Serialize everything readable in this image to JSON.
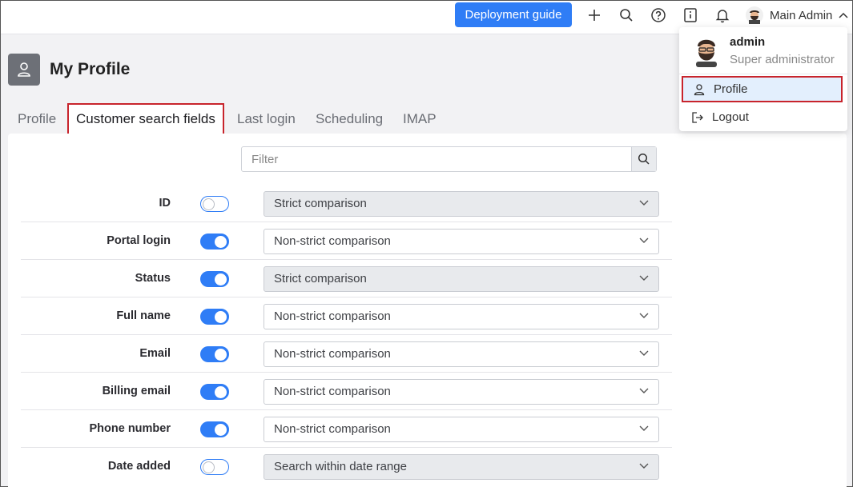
{
  "topbar": {
    "deploy_label": "Deployment guide",
    "icons": [
      "plus-icon",
      "search-icon",
      "help-icon",
      "info-icon",
      "bell-icon"
    ],
    "user_label": "Main Admin"
  },
  "page": {
    "title": "My Profile"
  },
  "tabs": [
    {
      "label": "Profile",
      "active": false
    },
    {
      "label": "Customer search fields",
      "active": true
    },
    {
      "label": "Last login",
      "active": false
    },
    {
      "label": "Scheduling",
      "active": false
    },
    {
      "label": "IMAP",
      "active": false
    }
  ],
  "filter": {
    "placeholder": "Filter",
    "value": ""
  },
  "fields": [
    {
      "label": "ID",
      "enabled": false,
      "mode": "Strict comparison"
    },
    {
      "label": "Portal login",
      "enabled": true,
      "mode": "Non-strict comparison"
    },
    {
      "label": "Status",
      "enabled": true,
      "mode": "Strict comparison",
      "select_disabled": true
    },
    {
      "label": "Full name",
      "enabled": true,
      "mode": "Non-strict comparison"
    },
    {
      "label": "Email",
      "enabled": true,
      "mode": "Non-strict comparison"
    },
    {
      "label": "Billing email",
      "enabled": true,
      "mode": "Non-strict comparison"
    },
    {
      "label": "Phone number",
      "enabled": true,
      "mode": "Non-strict comparison"
    },
    {
      "label": "Date added",
      "enabled": false,
      "mode": "Search within date range"
    }
  ],
  "dropdown": {
    "name": "admin",
    "role": "Super administrator",
    "items": [
      {
        "label": "Profile",
        "icon": "user-icon",
        "active": true
      },
      {
        "label": "Logout",
        "icon": "logout-icon",
        "active": false
      }
    ]
  },
  "colors": {
    "accent": "#2f7df6",
    "highlight": "#c8242c"
  }
}
